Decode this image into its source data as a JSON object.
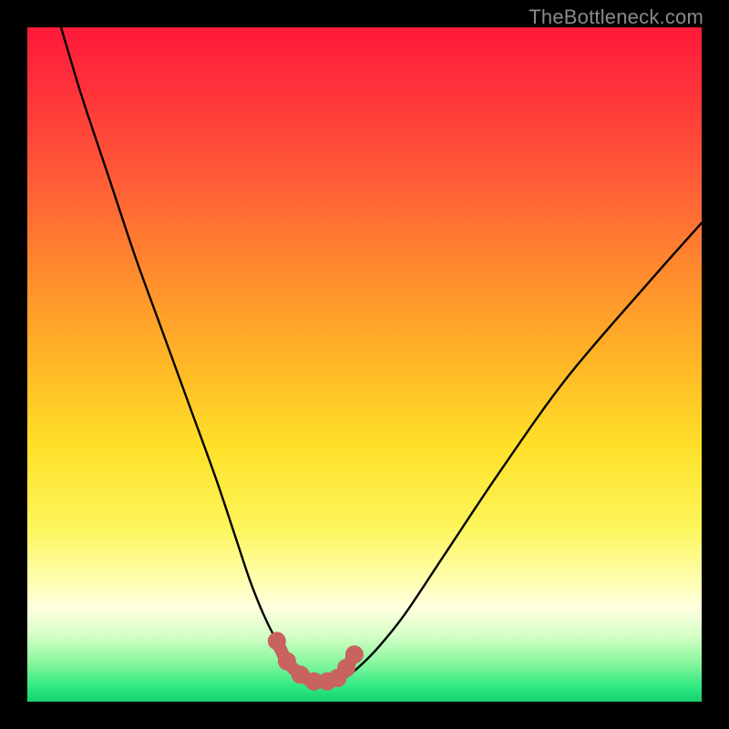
{
  "attribution": "TheBottleneck.com",
  "colors": {
    "frame": "#000000",
    "curve": "#000000",
    "marker_stroke": "#c9635f",
    "marker_fill": "#c9635f",
    "gradient_stops": [
      "#ff1a3a",
      "#ff5a38",
      "#ff8a2e",
      "#ffb726",
      "#ffe029",
      "#fdf55a",
      "#ffffe0",
      "#8ef7a0",
      "#18d070"
    ]
  },
  "chart_data": {
    "type": "line",
    "title": "",
    "xlabel": "",
    "ylabel": "",
    "xlim": [
      0,
      100
    ],
    "ylim": [
      0,
      100
    ],
    "grid": false,
    "legend": null,
    "annotations": [],
    "series": [
      {
        "name": "bottleneck-curve",
        "x": [
          5,
          8,
          12,
          16,
          20,
          24,
          28,
          31,
          33,
          35,
          37,
          39,
          41,
          43,
          45,
          47,
          49,
          52,
          56,
          62,
          70,
          80,
          92,
          100
        ],
        "y": [
          100,
          90,
          78,
          66,
          55,
          44,
          33,
          24,
          18,
          13,
          9,
          6,
          4,
          3,
          3,
          3.5,
          5,
          8,
          13,
          22,
          34,
          48,
          62,
          71
        ]
      }
    ],
    "markers": {
      "name": "trough-markers",
      "x": [
        37,
        38.5,
        40.5,
        42.5,
        44.5,
        46,
        47.3,
        48.5
      ],
      "y": [
        9,
        6,
        4,
        3,
        3,
        3.5,
        5,
        7
      ]
    }
  }
}
